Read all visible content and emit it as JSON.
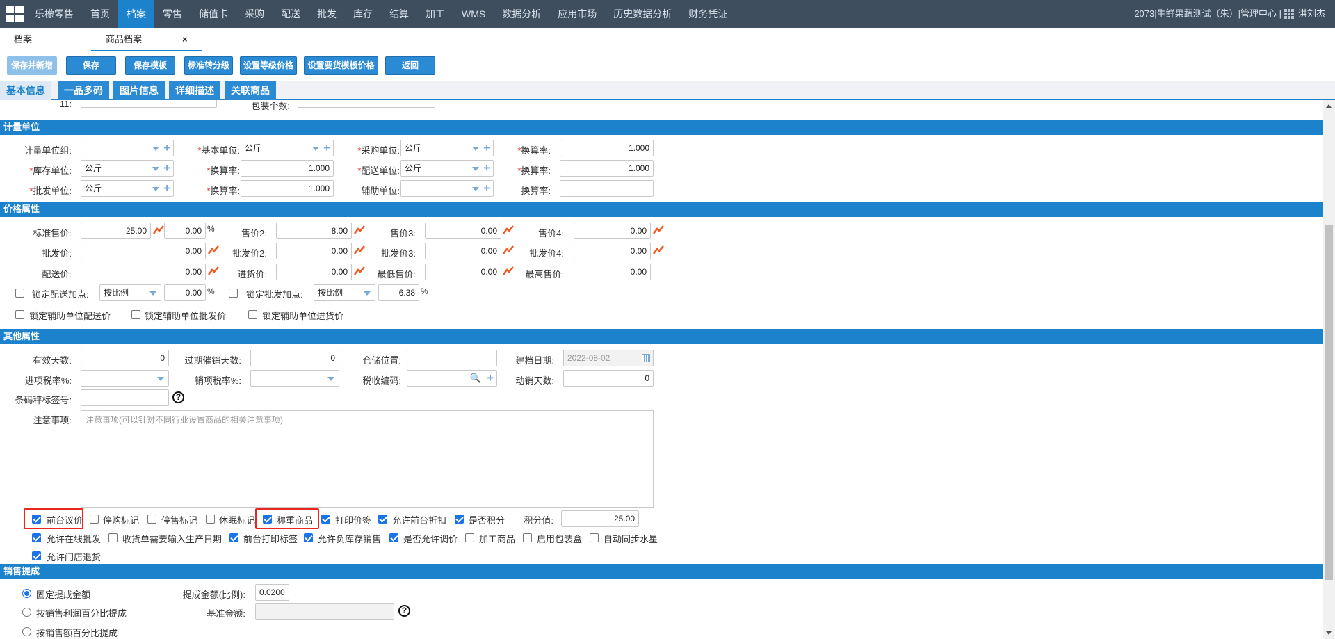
{
  "topbar": {
    "nav": [
      "乐檬零售",
      "首页",
      "档案",
      "零售",
      "储值卡",
      "采购",
      "配送",
      "批发",
      "库存",
      "结算",
      "加工",
      "WMS",
      "数据分析",
      "应用市场",
      "历史数据分析",
      "财务凭证"
    ],
    "active": "档案",
    "user_text": "2073|生鲜果蔬测试（朱）|管理中心 |",
    "user_name": "洪刘杰"
  },
  "page_tabs": {
    "tab1": "档案",
    "tab2": "商品档案",
    "close": "×"
  },
  "toolbar": {
    "save_new": "保存并新增",
    "save": "保存",
    "save_tpl": "保存模板",
    "std_grade": "标准转分级",
    "grade_price": "设置等级价格",
    "tpl_price": "设置要货模板价格",
    "back": "返回"
  },
  "subtabs": [
    "基本信息",
    "一品多码",
    "图片信息",
    "详细描述",
    "关联商品"
  ],
  "top_row": {
    "label_11": "11:",
    "pack_count": "包装个数:"
  },
  "unit_section": {
    "title": "计量单位",
    "unit_group": "计量单位组:",
    "base_unit": "基本单位:",
    "base_unit_val": "公斤",
    "purchase_unit": "采购单位:",
    "purchase_unit_val": "公斤",
    "rate": "换算率:",
    "rate1": "1.000",
    "stock_unit": "库存单位:",
    "stock_unit_val": "公斤",
    "rate2": "1.000",
    "dist_unit": "配送单位:",
    "dist_unit_val": "公斤",
    "rate3": "1.000",
    "wholesale_unit": "批发单位:",
    "wholesale_unit_val": "公斤",
    "rate4": "1.000",
    "aux_unit": "辅助单位:"
  },
  "price_section": {
    "title": "价格属性",
    "std_price": "标准售价:",
    "std_price_val": "25.00",
    "std_pct": "0.00",
    "pct": "%",
    "price2": "售价2:",
    "price2_val": "8.00",
    "price3": "售价3:",
    "price3_val": "0.00",
    "price4": "售价4:",
    "price4_val": "0.00",
    "wholesale": "批发价:",
    "wholesale_val": "0.00",
    "wholesale2": "批发价2:",
    "wholesale2_val": "0.00",
    "wholesale3": "批发价3:",
    "wholesale3_val": "0.00",
    "wholesale4": "批发价4:",
    "wholesale4_val": "0.00",
    "dist_price": "配送价:",
    "dist_price_val": "0.00",
    "cost_price": "进货价:",
    "cost_price_val": "0.00",
    "min_price": "最低售价:",
    "min_price_val": "0.00",
    "max_price": "最高售价:",
    "max_price_val": "0.00",
    "lock_dist": "锁定配送加点:",
    "lock_dist_mode": "按比例",
    "lock_dist_val": "0.00",
    "lock_ws": "锁定批发加点:",
    "lock_ws_mode": "按比例",
    "lock_ws_val": "6.38",
    "lock_aux_dist": "锁定辅助单位配送价",
    "lock_aux_ws": "锁定辅助单位批发价",
    "lock_aux_cost": "锁定辅助单位进货价"
  },
  "other_section": {
    "title": "其他属性",
    "valid_days": "有效天数:",
    "valid_days_val": "0",
    "expire_days": "过期催销天数:",
    "expire_days_val": "0",
    "location": "仓储位置:",
    "create_date": "建档日期:",
    "create_date_val": "2022-08-02",
    "in_tax": "进项税率%:",
    "out_tax": "销项税率%:",
    "tax_code": "税收编码:",
    "move_days": "动销天数:",
    "move_days_val": "0",
    "barcode_tag": "条码秤标签号:",
    "notes": "注意事项:",
    "notes_placeholder": "注意事项(可以针对不同行业设置商品的相关注意事项)",
    "flags1": [
      {
        "label": "前台议价",
        "on": true
      },
      {
        "label": "停购标记",
        "on": false
      },
      {
        "label": "停售标记",
        "on": false
      },
      {
        "label": "休眠标记",
        "on": false
      },
      {
        "label": "称重商品",
        "on": true
      },
      {
        "label": "打印价签",
        "on": true
      },
      {
        "label": "允许前台折扣",
        "on": true
      },
      {
        "label": "是否积分",
        "on": true
      }
    ],
    "points": "积分值:",
    "points_val": "25.00",
    "flags2": [
      {
        "label": "允许在线批发",
        "on": true
      },
      {
        "label": "收货单需要输入生产日期",
        "on": false
      },
      {
        "label": "前台打印标签",
        "on": true
      },
      {
        "label": "允许负库存销售",
        "on": true
      },
      {
        "label": "是否允许调价",
        "on": true
      },
      {
        "label": "加工商品",
        "on": false
      },
      {
        "label": "启用包装盒",
        "on": false
      },
      {
        "label": "自动同步水星",
        "on": false
      }
    ],
    "allow_return": "允许门店退货"
  },
  "commission_section": {
    "title": "销售提成",
    "fixed": "固定提成金额",
    "by_profit": "按销售利润百分比提成",
    "by_sales": "按销售额百分比提成",
    "amount": "提成金额(比例):",
    "amount_val": "0.0200",
    "base": "基准金额:"
  },
  "colors": {
    "nav_bg": "#3f4e5f",
    "accent": "#1c82cc",
    "highlight": "#e8281e",
    "trend": "#f15a24"
  },
  "icons": [
    "grid-logo-icon",
    "apps-grid-icon",
    "close-icon",
    "chevron-down-icon",
    "plus-icon",
    "search-icon",
    "trend-icon",
    "calendar-icon",
    "help-icon"
  ]
}
